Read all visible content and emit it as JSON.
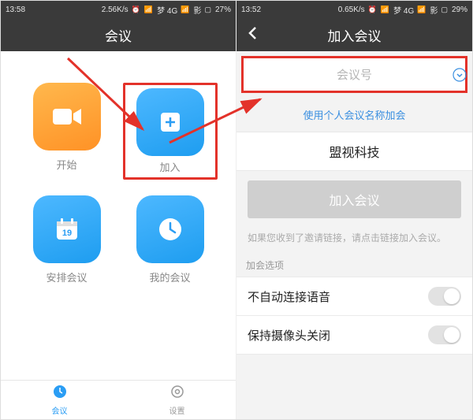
{
  "left": {
    "status": {
      "time": "13:58",
      "speed": "2.56K/s",
      "net": "梦 4G",
      "signal": "影",
      "battery": "27%"
    },
    "header": {
      "title": "会议"
    },
    "tiles": {
      "start": "开始",
      "join": "加入",
      "schedule": "安排会议",
      "mine": "我的会议"
    },
    "nav": {
      "meeting": "会议",
      "settings": "设置"
    }
  },
  "right": {
    "status": {
      "time": "13:52",
      "speed": "0.65K/s",
      "net": "梦 4G",
      "signal": "影",
      "battery": "29%"
    },
    "header": {
      "title": "加入会议"
    },
    "input_placeholder": "会议号",
    "personal_link": "使用个人会议名称加会",
    "company": "盟视科技",
    "join_btn": "加入会议",
    "hint": "如果您收到了邀请链接，请点击链接加入会议。",
    "section": "加会选项",
    "toggle_audio": "不自动连接语音",
    "toggle_camera": "保持摄像头关闭"
  }
}
